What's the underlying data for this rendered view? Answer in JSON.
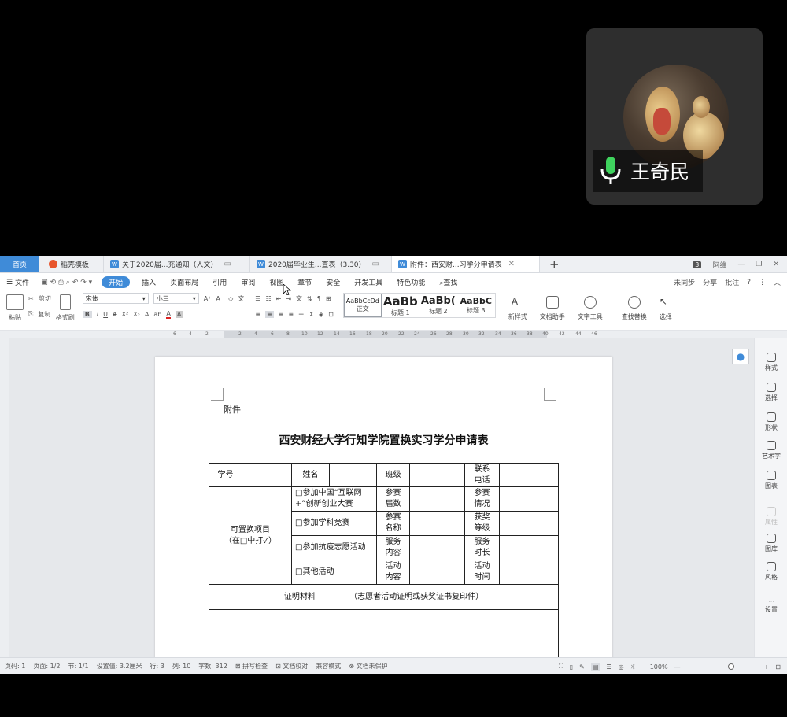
{
  "participant": {
    "name": "王奇民",
    "mic_status": "mic-on"
  },
  "tabs": {
    "home": "首页",
    "items": [
      {
        "label": "稻壳模板",
        "icon": "daoke-icon",
        "color": "#e8552c"
      },
      {
        "label": "关于2020届...充通知（人文）",
        "icon": "wps-doc-icon",
        "color": "#3f8bd8"
      },
      {
        "label": "2020届毕业生...查表（3.30）",
        "icon": "wps-doc-icon",
        "color": "#3f8bd8"
      },
      {
        "label": "附件：西安财...习学分申请表",
        "icon": "wps-doc-icon",
        "color": "#3f8bd8"
      }
    ],
    "plus": "+",
    "badge": "3",
    "user": "阿维"
  },
  "menu": {
    "file": "文件",
    "items": [
      "开始",
      "插入",
      "页面布局",
      "引用",
      "审阅",
      "视图",
      "章节",
      "安全",
      "开发工具",
      "特色功能"
    ],
    "search": "查找",
    "right": [
      "未同步",
      "分享",
      "批注",
      "?"
    ]
  },
  "ribbon": {
    "paste": "粘贴",
    "cut": "剪切",
    "copy": "复制",
    "format_painter": "格式刷",
    "font_name": "宋体",
    "font_size": "小三",
    "styles": [
      {
        "sample": "AaBbCcDd",
        "label": "正文"
      },
      {
        "sample": "AaBb",
        "label": "标题 1"
      },
      {
        "sample": "AaBb(",
        "label": "标题 2"
      },
      {
        "sample": "AaBbC",
        "label": "标题 3"
      }
    ],
    "new_style": "新样式",
    "doc_helper": "文档助手",
    "text_tools": "文字工具",
    "find_replace": "查找替换",
    "select": "选择"
  },
  "ruler": [
    "6",
    "4",
    "2",
    "2",
    "4",
    "6",
    "8",
    "10",
    "12",
    "14",
    "16",
    "18",
    "20",
    "22",
    "24",
    "26",
    "28",
    "30",
    "32",
    "34",
    "36",
    "38",
    "40",
    "42",
    "44",
    "46"
  ],
  "document": {
    "attachment": "附件",
    "title": "西安财经大学行知学院置换实习学分申请表",
    "table": {
      "r1": [
        "学号",
        "",
        "姓名",
        "",
        "班级",
        "",
        "联系\n电话",
        ""
      ],
      "left_label": "可置换项目\n（在□中打✓）",
      "rows": [
        {
          "item": "□参加中国“互联网+”创新创业大赛",
          "c1": "参赛\n届数",
          "c2": "参赛\n情况"
        },
        {
          "item": "□参加学科竞赛",
          "c1": "参赛\n名称",
          "c2": "获奖\n等级"
        },
        {
          "item": "□参加抗疫志愿活动",
          "c1": "服务\n内容",
          "c2": "服务\n时长"
        },
        {
          "item": "□其他活动",
          "c1": "活动\n内容",
          "c2": "活动\n时间"
        }
      ],
      "proof_label": "证明材料",
      "proof_note": "（志愿者活动证明或获奖证书复印件）"
    }
  },
  "right_panel": [
    "样式",
    "选择",
    "形状",
    "艺术字",
    "图表",
    "属性",
    "图库",
    "风格",
    "设置"
  ],
  "status": {
    "items": [
      "页码: 1",
      "页面: 1/2",
      "节: 1/1",
      "设置值: 3.2厘米",
      "行: 3",
      "列: 10",
      "字数: 312",
      "拼写检查",
      "文档校对",
      "兼容模式",
      "文档未保护"
    ],
    "zoom": "100%"
  }
}
